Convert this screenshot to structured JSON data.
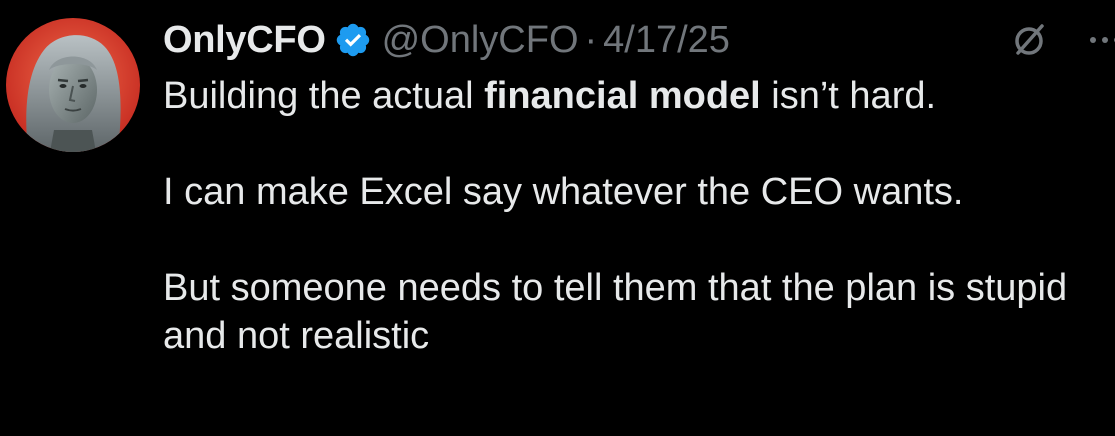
{
  "author": {
    "display_name": "OnlyCFO",
    "handle": "@OnlyCFO",
    "separator": "·",
    "date": "4/17/25",
    "verified": true,
    "avatar_icon": "avatar-portrait",
    "avatar_ring_color": "#e0483a"
  },
  "actions": {
    "grok_icon": "grok-icon",
    "more_icon": "more-icon"
  },
  "tweet": {
    "line1_pre": "Building the actual ",
    "line1_bold": "financial model",
    "line1_post": " isn’t hard.",
    "para2": "I can make Excel say whatever the CEO wants.",
    "para3": "But someone needs to tell them that the plan is stupid and not realistic"
  },
  "colors": {
    "background": "#000000",
    "text": "#e7e9ea",
    "secondary": "#71767b",
    "verified": "#1d9bf0"
  }
}
